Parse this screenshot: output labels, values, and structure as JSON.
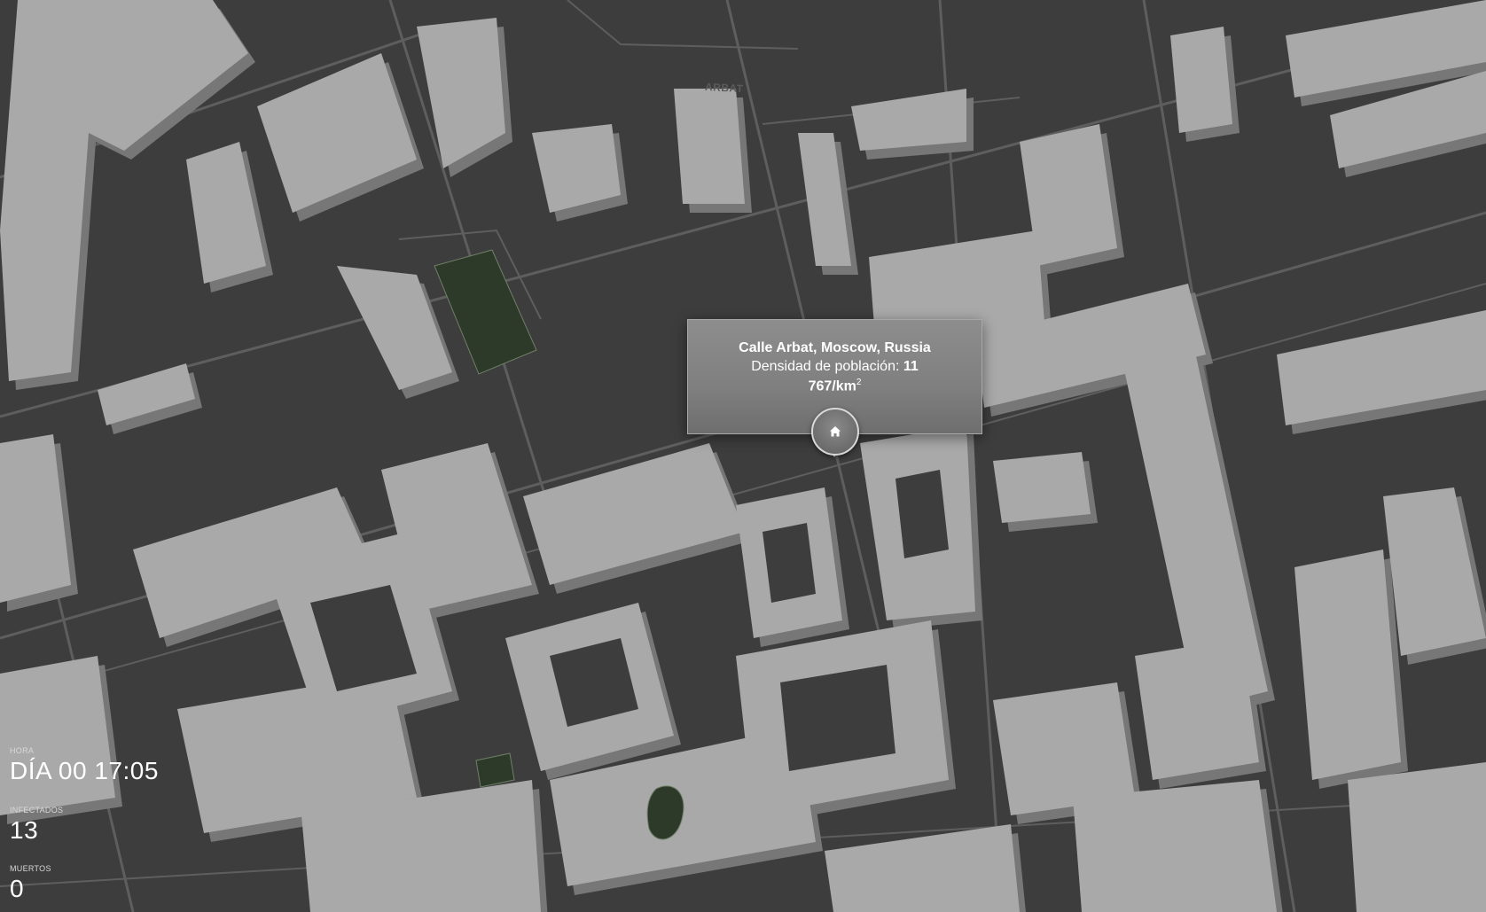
{
  "map": {
    "street_label": "ARBAT",
    "colors": {
      "ground": "#3d3d3d",
      "road": "#5a5a5a",
      "building_top": "#a9a9a9",
      "building_side": "#7a7a7a",
      "park": "#2e3a29"
    }
  },
  "popup": {
    "title": "Calle Arbat, Moscow, Russia",
    "density_label": "Densidad de población:",
    "density_value_part1": "11",
    "density_value_part2": "767/km",
    "density_superscript": "2",
    "pin_icon": "home-icon"
  },
  "hud": {
    "time_caption": "HORA",
    "time_value": "DÍA 00 17:05",
    "infected_caption": "INFECTADOS",
    "infected_value": "13",
    "dead_caption": "MUERTOS",
    "dead_value": "0"
  }
}
